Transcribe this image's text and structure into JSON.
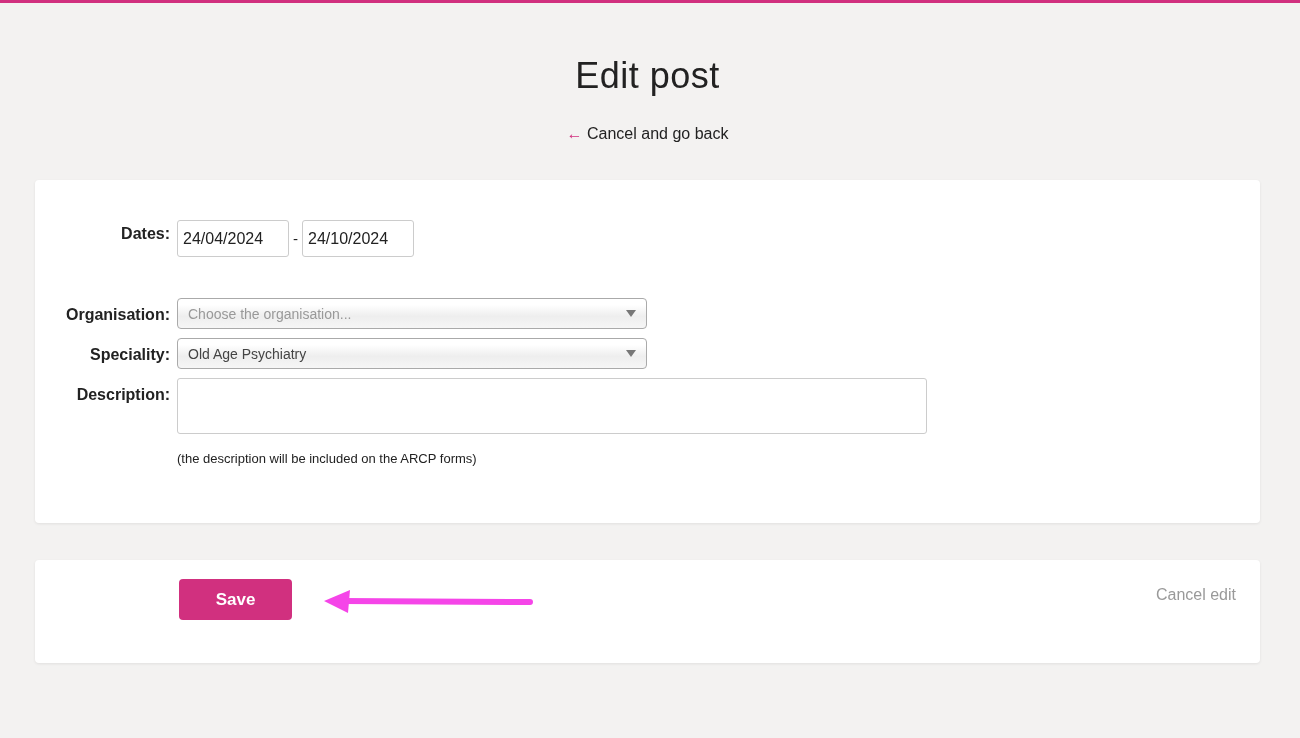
{
  "page": {
    "title": "Edit post",
    "back_link": {
      "icon": "←",
      "label": "Cancel and go back"
    }
  },
  "form": {
    "dates": {
      "label": "Dates:",
      "start": "24/04/2024",
      "separator": "-",
      "end": "24/10/2024"
    },
    "organisation": {
      "label": "Organisation:",
      "placeholder": "Choose the organisation..."
    },
    "speciality": {
      "label": "Speciality:",
      "value": "Old Age Psychiatry"
    },
    "description": {
      "label": "Description:",
      "hint": "(the description will be included on the ARCP forms)"
    }
  },
  "actions": {
    "save": "Save",
    "cancel": "Cancel edit"
  }
}
